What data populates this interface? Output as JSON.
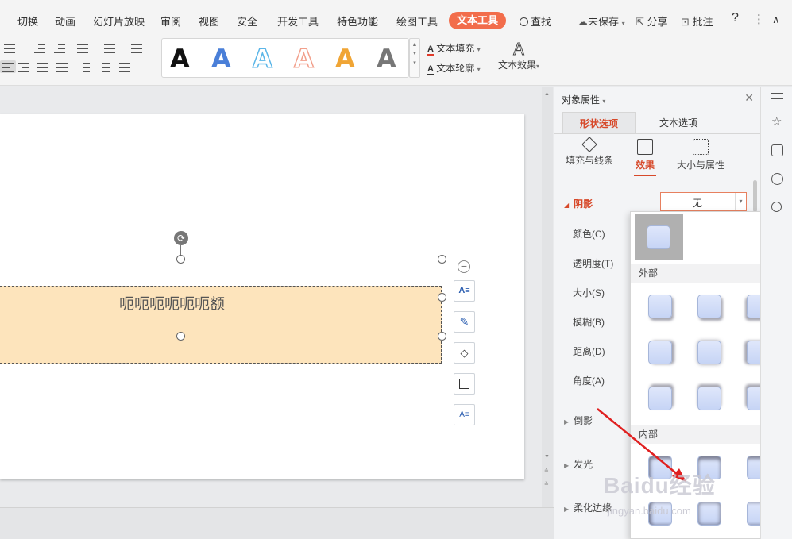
{
  "menu": {
    "items": [
      "切换",
      "动画",
      "幻灯片放映",
      "审阅",
      "视图",
      "安全",
      "开发工具",
      "特色功能",
      "绘图工具"
    ],
    "active": "文本工具",
    "search": "查找",
    "save_state": "未保存",
    "share": "分享",
    "comment": "批注",
    "help": "?",
    "more": "⋮",
    "collapse": "∧"
  },
  "toolbar": {
    "art_letters": [
      "A",
      "A",
      "A",
      "A",
      "A",
      "A"
    ],
    "art_colors": [
      "#111111",
      "#4a7fd8",
      "#5bb6e8",
      "#f2a08c",
      "#f0a535",
      "#777777"
    ],
    "text_fill": "文本填充",
    "text_outline": "文本轮廓",
    "text_effect": "文本效果"
  },
  "slide": {
    "shape_text": "呃呃呃呃呃呃额",
    "fill_color": "#fde4bc"
  },
  "pane": {
    "title": "对象属性",
    "tabs": [
      "形状选项",
      "文本选项"
    ],
    "subtabs": [
      "填充与线条",
      "效果",
      "大小与属性"
    ],
    "shadow_label": "阴影",
    "shadow_value": "无",
    "props": [
      "颜色(C)",
      "透明度(T)",
      "大小(S)",
      "模糊(B)",
      "距离(D)",
      "角度(A)"
    ],
    "sections": [
      "倒影",
      "发光",
      "柔化边缘"
    ]
  },
  "dropdown": {
    "outer_label": "外部",
    "inner_label": "内部"
  },
  "watermark": {
    "brand": "Baidu经验",
    "url": "jingyan.baidu.com"
  },
  "colors": {
    "accent": "#f26d4b",
    "selected_text": "#d7492a"
  }
}
